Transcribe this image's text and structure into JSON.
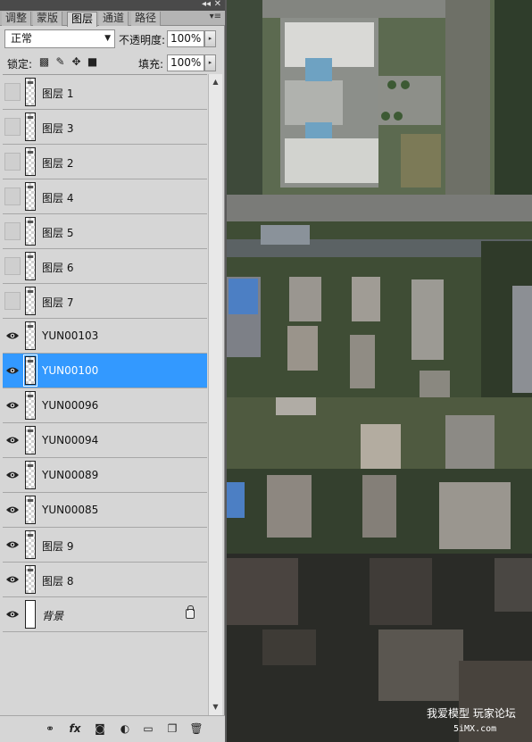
{
  "tabs": [
    "调整",
    "蒙版",
    "图层",
    "通道",
    "路径"
  ],
  "active_tab": "图层",
  "blend_mode": "正常",
  "opacity_label": "不透明度:",
  "opacity_value": "100%",
  "lock_label": "锁定:",
  "fill_label": "填充:",
  "fill_value": "100%",
  "layers": [
    {
      "name": "图层 1",
      "visible": false,
      "selected": false
    },
    {
      "name": "图层 3",
      "visible": false,
      "selected": false
    },
    {
      "name": "图层 2",
      "visible": false,
      "selected": false
    },
    {
      "name": "图层 4",
      "visible": false,
      "selected": false
    },
    {
      "name": "图层 5",
      "visible": false,
      "selected": false
    },
    {
      "name": "图层 6",
      "visible": false,
      "selected": false
    },
    {
      "name": "图层 7",
      "visible": false,
      "selected": false
    },
    {
      "name": "YUN00103",
      "visible": true,
      "selected": false
    },
    {
      "name": "YUN00100",
      "visible": true,
      "selected": true
    },
    {
      "name": "YUN00096",
      "visible": true,
      "selected": false
    },
    {
      "name": "YUN00094",
      "visible": true,
      "selected": false
    },
    {
      "name": "YUN00089",
      "visible": true,
      "selected": false
    },
    {
      "name": "YUN00085",
      "visible": true,
      "selected": false
    },
    {
      "name": "图层 9",
      "visible": true,
      "selected": false
    },
    {
      "name": "图层 8",
      "visible": true,
      "selected": false
    },
    {
      "name": "背景",
      "visible": true,
      "selected": false,
      "locked": true,
      "background": true
    }
  ],
  "toolbar_icons": [
    "link-layers-icon",
    "fx-icon",
    "add-mask-icon",
    "adjustment-layer-icon",
    "new-group-icon",
    "new-layer-icon",
    "delete-icon"
  ],
  "toolbar_fx_text": "fx",
  "watermark": {
    "text": "我爱模型 玩家论坛",
    "url": "5iMX.com"
  },
  "colors": {
    "selected": "#3399ff",
    "panel": "#d6d6d6"
  }
}
